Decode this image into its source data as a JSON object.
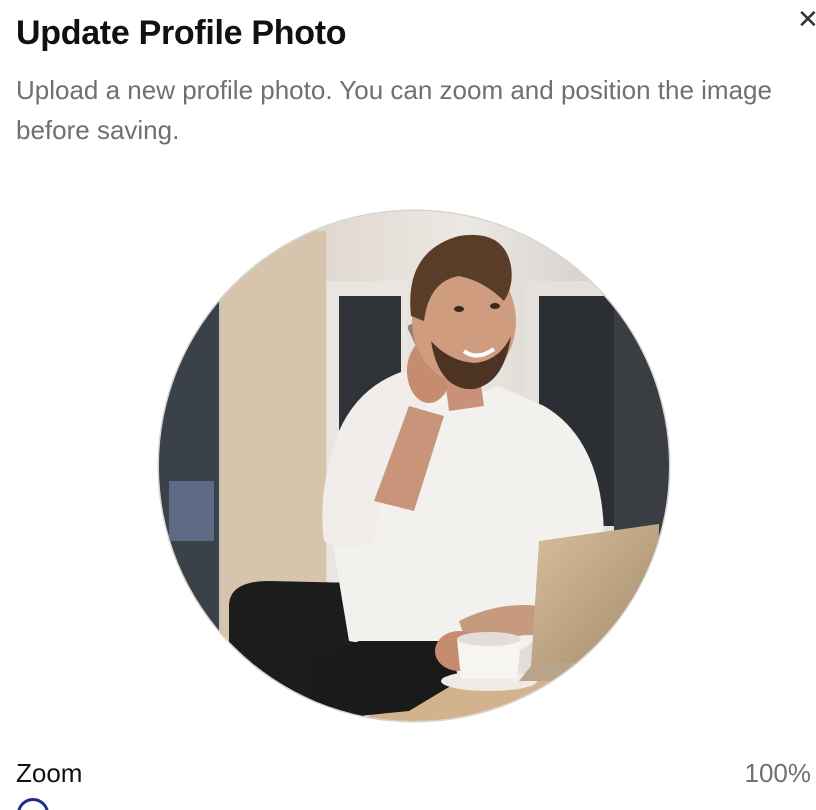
{
  "dialog": {
    "title": "Update Profile Photo",
    "close_icon": "close-icon",
    "close_glyph": "✕",
    "description": "Upload a new profile photo. You can zoom and position the image before saving."
  },
  "photo": {
    "subject": "profile-photo"
  },
  "zoom": {
    "label": "Zoom",
    "value_text": "100%",
    "value": 100,
    "accent_color": "#1f2f8c"
  }
}
